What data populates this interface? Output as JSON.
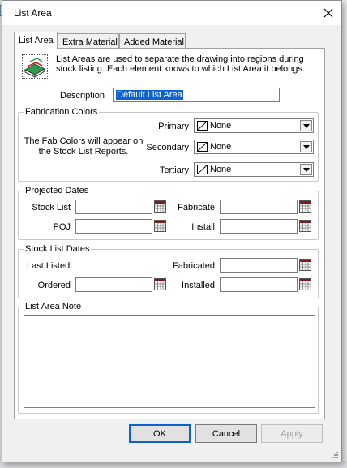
{
  "window": {
    "title": "List Area",
    "close_icon": "close-icon"
  },
  "tabs": [
    {
      "label": "List Area",
      "active": true
    },
    {
      "label": "Extra Material",
      "active": false
    },
    {
      "label": "Added Material",
      "active": false
    }
  ],
  "intro": {
    "icon": "book-icon",
    "text": "List Areas are used to separate the drawing into regions during stock listing. Each element knows to which List Area it belongs."
  },
  "description": {
    "label": "Description",
    "value": "Default List Area"
  },
  "fab_colors": {
    "title": "Fabrication Colors",
    "note": "The Fab Colors will appear on the Stock List Reports.",
    "primary": {
      "label": "Primary",
      "value": "None"
    },
    "secondary": {
      "label": "Secondary",
      "value": "None"
    },
    "tertiary": {
      "label": "Tertiary",
      "value": "None"
    }
  },
  "projected_dates": {
    "title": "Projected Dates",
    "stock_list": {
      "label": "Stock List",
      "value": ""
    },
    "fabricate": {
      "label": "Fabricate",
      "value": ""
    },
    "poj": {
      "label": "POJ",
      "value": ""
    },
    "install": {
      "label": "Install",
      "value": ""
    }
  },
  "stock_list_dates": {
    "title": "Stock List Dates",
    "last_listed": {
      "label": "Last Listed:"
    },
    "fabricated": {
      "label": "Fabricated",
      "value": ""
    },
    "ordered": {
      "label": "Ordered",
      "value": ""
    },
    "installed": {
      "label": "Installed",
      "value": ""
    }
  },
  "note": {
    "title": "List Area Note",
    "value": ""
  },
  "buttons": {
    "ok": "OK",
    "cancel": "Cancel",
    "apply": "Apply"
  },
  "colors": {
    "selection": "#0a63d1",
    "panel": "#ffffff",
    "dialog": "#f0f0f0"
  }
}
